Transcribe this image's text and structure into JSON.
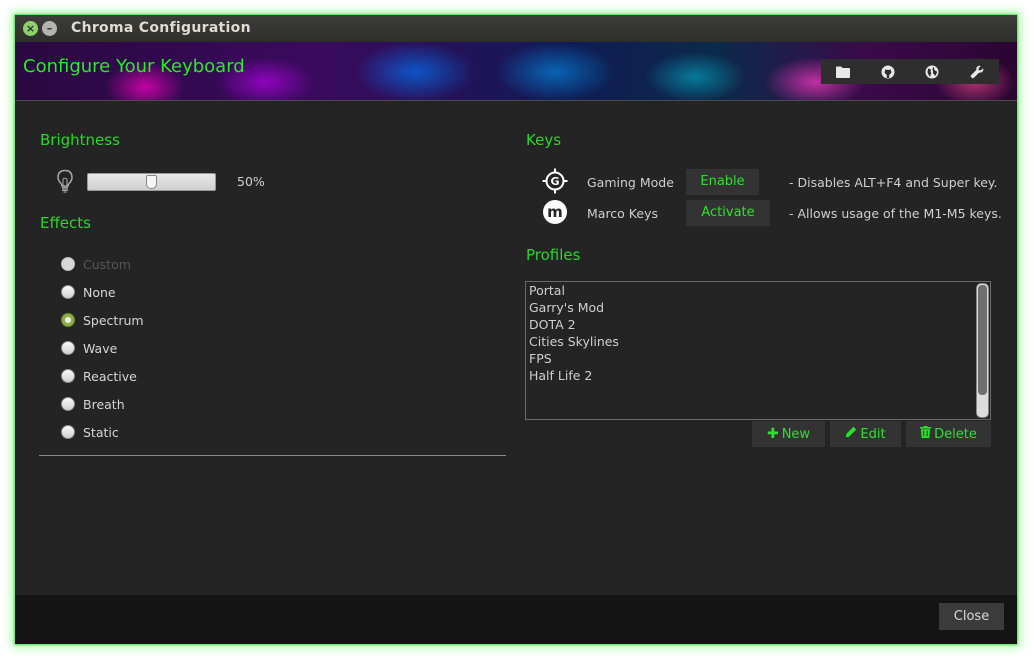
{
  "window": {
    "title": "Chroma Configuration",
    "close_glyph": "×",
    "minimize_glyph": "–"
  },
  "header": {
    "title": "Configure Your Keyboard",
    "toolbar_icons": [
      "folder-icon",
      "github-icon",
      "globe-icon",
      "wrench-icon"
    ]
  },
  "brightness": {
    "title": "Brightness",
    "icon": "lightbulb-icon",
    "value_label": "50%",
    "value": 0.5
  },
  "effects": {
    "title": "Effects",
    "options": [
      {
        "label": "Custom",
        "state": "disabled"
      },
      {
        "label": "None",
        "state": "unchecked"
      },
      {
        "label": "Spectrum",
        "state": "checked"
      },
      {
        "label": "Wave",
        "state": "unchecked"
      },
      {
        "label": "Reactive",
        "state": "unchecked"
      },
      {
        "label": "Breath",
        "state": "unchecked"
      },
      {
        "label": "Static",
        "state": "unchecked"
      }
    ]
  },
  "keys": {
    "title": "Keys",
    "rows": [
      {
        "icon": "crosshair-g-icon",
        "name": "Gaming Mode",
        "button": "Enable",
        "desc": "- Disables ALT+F4 and Super key."
      },
      {
        "icon": "macro-m-icon",
        "name": "Marco Keys",
        "button": "Activate",
        "desc": "- Allows usage of the M1-M5 keys."
      }
    ],
    "macro_icon_letter": "m",
    "gaming_icon_letter": "G"
  },
  "profiles": {
    "title": "Profiles",
    "items": [
      "Portal",
      "Garry's Mod",
      "DOTA 2",
      "Cities Skylines",
      "FPS",
      "Half Life 2"
    ],
    "new_label": "New",
    "edit_label": "Edit",
    "delete_label": "Delete",
    "new_glyph": "✚"
  },
  "footer": {
    "close_label": "Close"
  },
  "colors": {
    "accent": "#29d629",
    "background": "#242424",
    "footer": "#141414"
  }
}
